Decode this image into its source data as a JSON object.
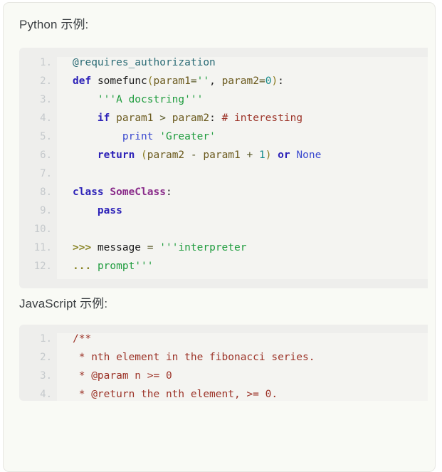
{
  "page": {
    "background": "#f9faf5",
    "border_color": "#e7e7e2"
  },
  "sections": [
    {
      "title": "Python 示例:",
      "language": "python"
    },
    {
      "title": "JavaScript 示例:",
      "language": "javascript"
    }
  ],
  "python_block": {
    "line_numbers": [
      "1.",
      "2.",
      "3.",
      "4.",
      "5.",
      "6.",
      "7.",
      "8.",
      "9.",
      "10.",
      "11.",
      "12."
    ],
    "lines": [
      "@requires_authorization",
      "def somefunc(param1='', param2=0):",
      "    '''A docstring'''",
      "    if param1 > param2: # interesting",
      "        print 'Greater'",
      "    return (param2 - param1 + 1) or None",
      "",
      "class SomeClass:",
      "    pass",
      "",
      ">>> message = '''interpreter",
      "... prompt'''"
    ]
  },
  "javascript_block": {
    "line_numbers": [
      "1.",
      "2.",
      "3.",
      "4."
    ],
    "lines": [
      "/**",
      " * nth element in the fibonacci series.",
      " * @param n >= 0",
      " * @return the nth element, >= 0."
    ]
  },
  "colors": {
    "decorator": "#2a6b75",
    "keyword": "#2d22b8",
    "builtin": "#3a49cf",
    "string": "#1f9c3e",
    "comment": "#9c3328",
    "number": "#178b8b",
    "param": "#6b5a1e",
    "class_name": "#8a2c8a",
    "prompt": "#8a8527",
    "line_number": "#c5c9cc",
    "code_bg": "#f4f4f1",
    "gutter_bg": "#eeeeec"
  }
}
